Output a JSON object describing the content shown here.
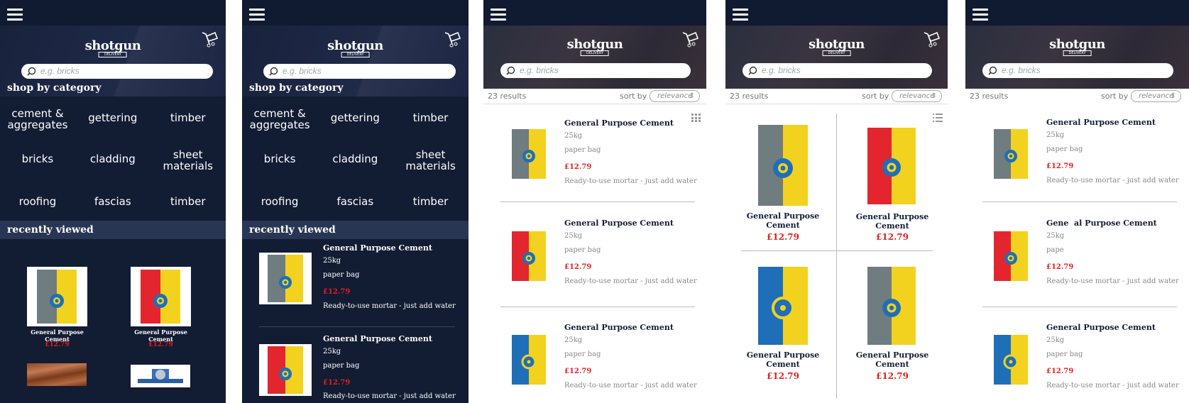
{
  "brand": {
    "name": "shotgun",
    "tagline": "DELIVERY"
  },
  "search": {
    "placeholder": "e.g. bricks"
  },
  "home": {
    "section_title": "shop by category",
    "categories": [
      "cement &\naggregates",
      "gettering",
      "timber",
      "bricks",
      "cladding",
      "sheet\nmaterials",
      "roofing",
      "fascias",
      "timber"
    ],
    "recently_viewed": "recently viewed"
  },
  "results": {
    "count": "23 results",
    "sort_label": "sort by",
    "sort_value": "relevance"
  },
  "products": [
    {
      "name": "General Purpose Cement",
      "weight": "25kg",
      "packaging": "paper bag",
      "price": "£12.79",
      "description": "Ready-to-use mortar - just add water",
      "bag": "grey"
    },
    {
      "name": "General Purpose Cement",
      "weight": "25kg",
      "packaging": "paper bag",
      "price": "£12.79",
      "description": "Ready-to-use mortar - just add water",
      "bag": "red"
    },
    {
      "name": "General Purpose Cement",
      "weight": "25kg",
      "packaging": "paper bag",
      "price": "£12.79",
      "description": "Ready-to-use mortar - just add water",
      "bag": "blue"
    },
    {
      "name": "General Purpose Cement",
      "price": "£12.79",
      "bag": "grey"
    }
  ],
  "screen5": {
    "name2": "Gene  al Purpose Cement",
    "packaging2": "pape"
  },
  "colors": {
    "navy": "#121c33",
    "price_red": "#e02020",
    "bag_yellow": "#f2d21e",
    "bag_grey": "#6f7c80",
    "bag_red": "#e3262e",
    "bag_blue": "#1f6fb8"
  }
}
